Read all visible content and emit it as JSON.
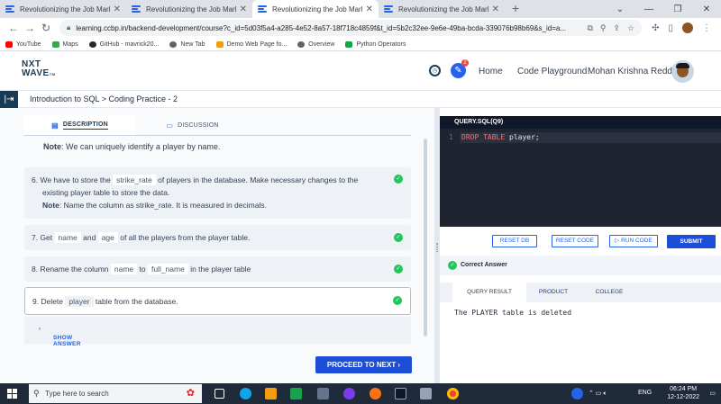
{
  "browser": {
    "tabs": [
      {
        "title": "Revolutionizing the Job Market |"
      },
      {
        "title": "Revolutionizing the Job Market |"
      },
      {
        "title": "Revolutionizing the Job Market |"
      },
      {
        "title": "Revolutionizing the Job Market |"
      }
    ],
    "url": "learning.ccbp.in/backend-development/course?c_id=5d03f5a4-a285-4e52-8a57-18f718c4859f&t_id=5b2c32ee-9e6e-49ba-bcda-339076b98b69&s_id=a...",
    "bookmarks": [
      {
        "label": "YouTube",
        "color": "#ff0000"
      },
      {
        "label": "Maps",
        "color": "#34a853"
      },
      {
        "label": "GitHub - mavrick20...",
        "color": "#24292e"
      },
      {
        "label": "New Tab",
        "color": "#5f6368"
      },
      {
        "label": "Demo Web Page fo...",
        "color": "#f59e0b"
      },
      {
        "label": "Overview",
        "color": "#5f6368"
      },
      {
        "label": "Python Operators",
        "color": "#16a34a"
      }
    ]
  },
  "header": {
    "logo_line1": "NXT",
    "logo_line2": "WAVE",
    "logo_tm": "TM",
    "notification_count": "2",
    "nav_home": "Home",
    "nav_playground": "Code Playground",
    "user_name": "Mohan Krishna Reddy"
  },
  "breadcrumb": "Introduction to SQL > Coding Practice - 2",
  "left": {
    "tab_description": "DESCRIPTION",
    "tab_discussion": "DISCUSSION",
    "note_top_label": "Note",
    "note_top_text": ": We can uniquely identify a player by name.",
    "q6_line1_a": "6.  We have to store the ",
    "q6_code": "strike_rate",
    "q6_line1_b": " of players in the database. Make necessary changes to the",
    "q6_line2": "existing player table to store the data.",
    "q6_note_label": "Note",
    "q6_note_text": ": Name the column as strike_rate. It is measured in decimals.",
    "q7_a": "7.  Get ",
    "q7_code1": "name",
    "q7_b": " and ",
    "q7_code2": "age",
    "q7_c": " of all the players from the player table.",
    "q8_a": "8.  Rename the column ",
    "q8_code1": "name",
    "q8_b": " to ",
    "q8_code2": "full_name",
    "q8_c": " in the player table",
    "q9_a": "9.  Delete ",
    "q9_code": "player",
    "q9_b": " table from the database.",
    "show_answer": "SHOW ANSWER",
    "proceed": "PROCEED TO NEXT"
  },
  "right": {
    "editor_title": "QUERY.SQL(Q9)",
    "line_number": "1",
    "code_kw1": "DROP",
    "code_kw2": "TABLE",
    "code_rest": " player;",
    "reset_db": "RESET DB",
    "reset_code": "RESET CODE",
    "run_code": "RUN CODE",
    "submit": "SUBMIT",
    "status": "Correct Answer",
    "result_tabs": [
      "QUERY RESULT",
      "PRODUCT",
      "COLLEGE"
    ],
    "result_text": "The PLAYER table is deleted"
  },
  "taskbar": {
    "search_placeholder": "Type here to search",
    "lang": "ENG",
    "time": "06:24 PM",
    "date": "12-12-2022"
  }
}
